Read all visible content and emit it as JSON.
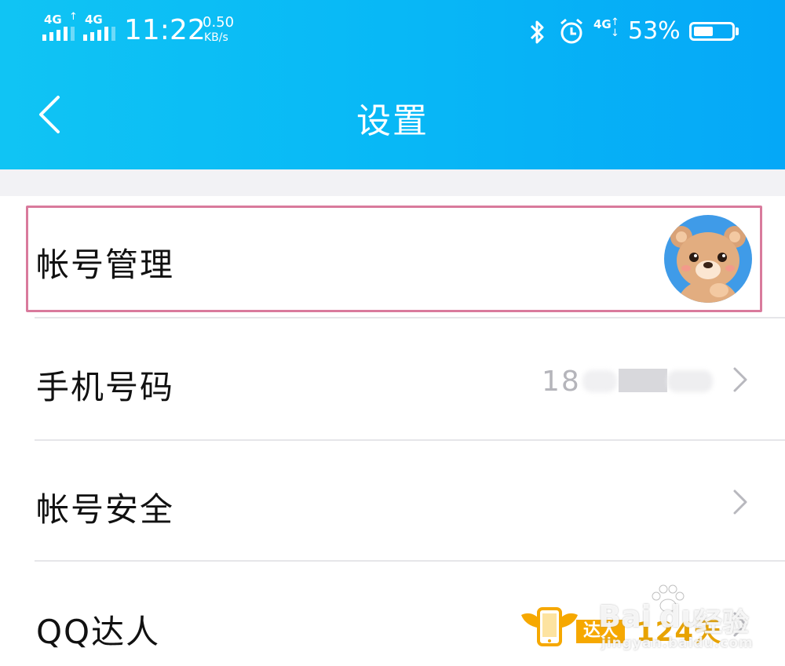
{
  "status_bar": {
    "signal1_label": "4G",
    "signal2_label": "4G",
    "time": "11:22",
    "net_speed_value": "0.50",
    "net_speed_unit": "KB/s",
    "mobile_data_label": "4G",
    "battery_percent": "53%",
    "battery_level": 53
  },
  "nav": {
    "title": "设置"
  },
  "rows": [
    {
      "label": "帐号管理"
    },
    {
      "label": "手机号码",
      "value": "18"
    },
    {
      "label": "帐号安全"
    },
    {
      "label": "QQ达人",
      "badge_tag": "达人",
      "badge_days": "124天"
    }
  ],
  "watermark": {
    "brand": "Bai",
    "brand2": "du",
    "cn": "经验",
    "url": "jingyan.baidu.com"
  },
  "colors": {
    "header_start": "#10c4f4",
    "header_end": "#05a8f7",
    "highlight": "#d97a9c",
    "badge_gold": "#f6a800"
  }
}
